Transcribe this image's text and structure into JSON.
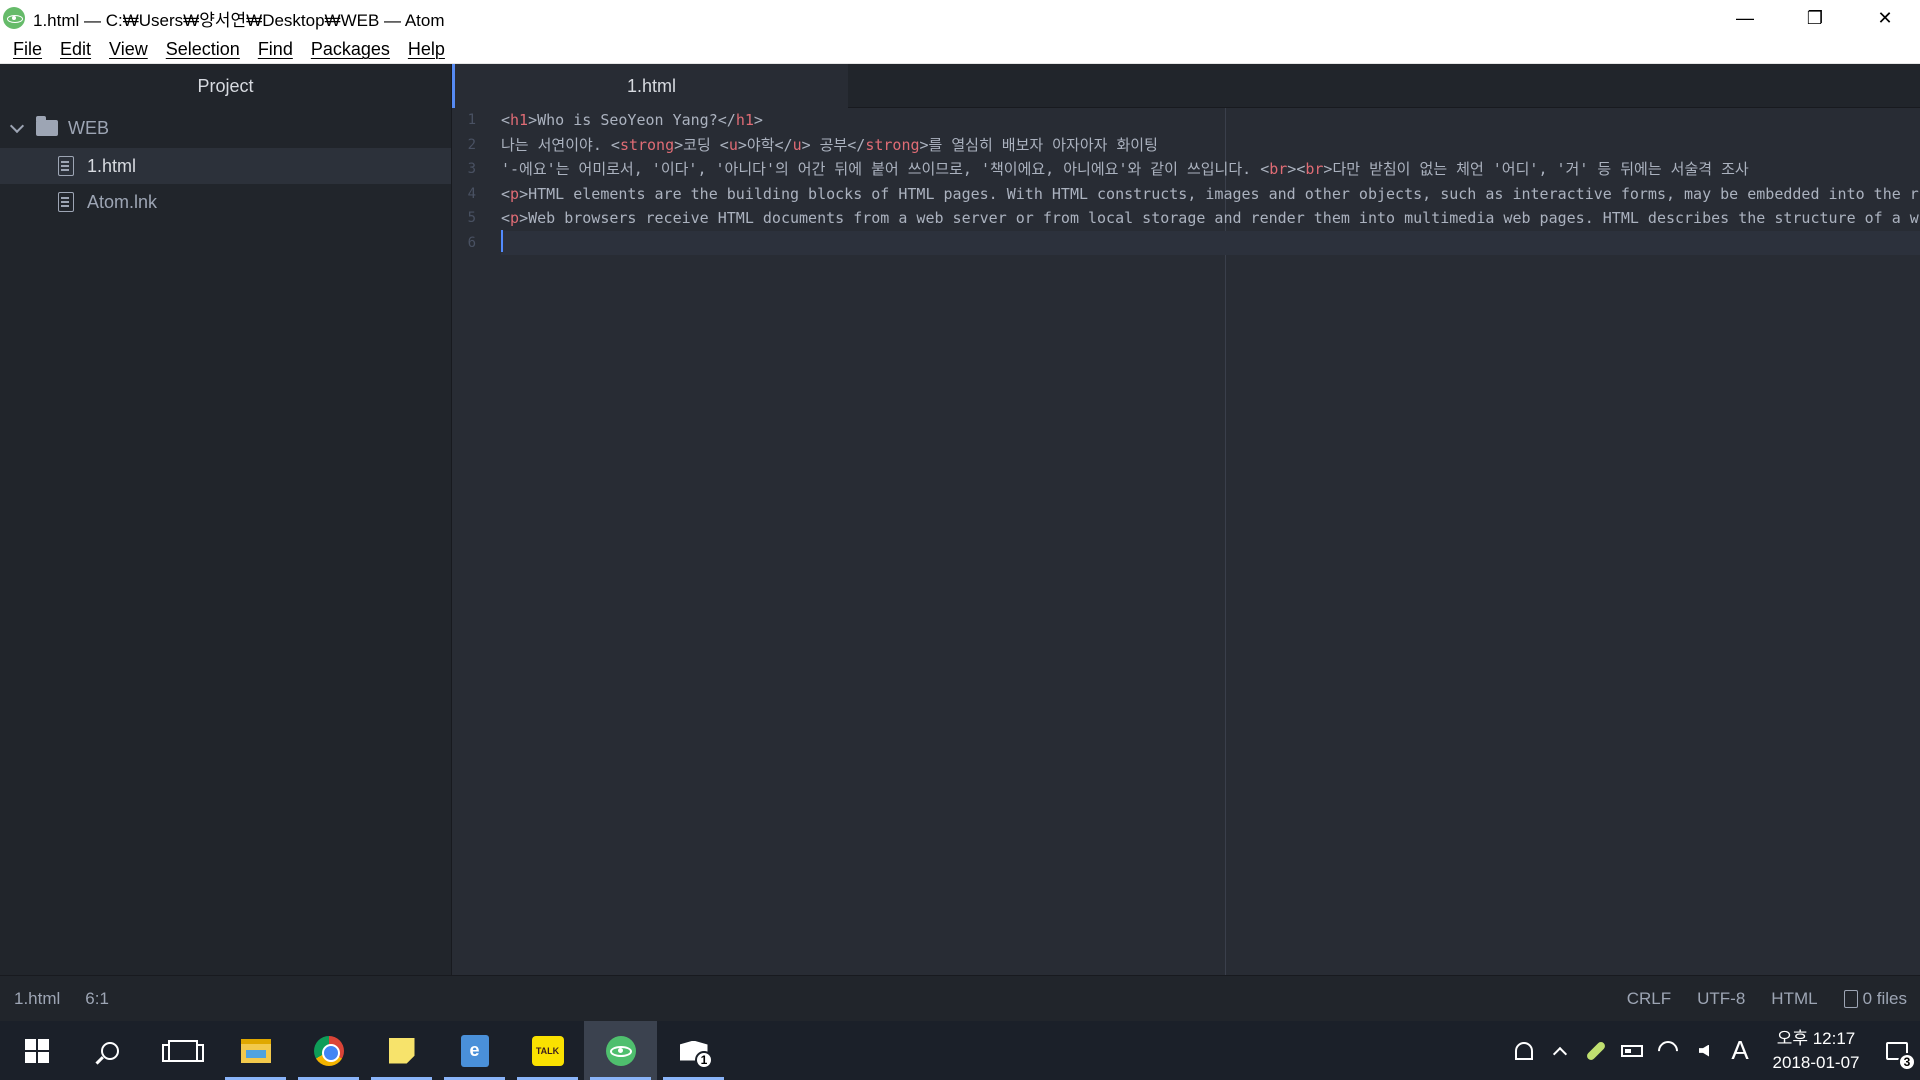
{
  "window": {
    "title": "1.html — C:₩Users₩양서연₩Desktop₩WEB — Atom",
    "controls": {
      "minimize": "—",
      "restore": "❐",
      "close": "✕"
    }
  },
  "menu": [
    "File",
    "Edit",
    "View",
    "Selection",
    "Find",
    "Packages",
    "Help"
  ],
  "tree": {
    "header": "Project",
    "root": "WEB",
    "files": [
      {
        "name": "1.html",
        "selected": true
      },
      {
        "name": "Atom.lnk",
        "selected": false
      }
    ]
  },
  "tabs": [
    {
      "label": "1.html",
      "active": true
    }
  ],
  "editor": {
    "line_numbers": [
      "1",
      "2",
      "3",
      "4",
      "5",
      "6"
    ],
    "lines": [
      [
        {
          "t": "<",
          "c": "punct"
        },
        {
          "t": "h1",
          "c": "tag"
        },
        {
          "t": ">Who is SeoYeon Yang?</",
          "c": "punct"
        },
        {
          "t": "h1",
          "c": "tag"
        },
        {
          "t": ">",
          "c": "punct"
        }
      ],
      [
        {
          "t": "나는 서연이야. <",
          "c": "punct"
        },
        {
          "t": "strong",
          "c": "tag"
        },
        {
          "t": ">코딩 <",
          "c": "punct"
        },
        {
          "t": "u",
          "c": "tag"
        },
        {
          "t": ">야학</",
          "c": "punct"
        },
        {
          "t": "u",
          "c": "tag"
        },
        {
          "t": "> 공부</",
          "c": "punct"
        },
        {
          "t": "strong",
          "c": "tag"
        },
        {
          "t": ">를 열심히 배보자 아자아자 화이팅",
          "c": "punct"
        }
      ],
      [
        {
          "t": "'-에요'는 어미로서, '이다', '아니다'의 어간 뒤에 붙어 쓰이므로, '책이에요, 아니에요'와 같이 쓰입니다. <",
          "c": "punct"
        },
        {
          "t": "br",
          "c": "tag"
        },
        {
          "t": "><",
          "c": "punct"
        },
        {
          "t": "br",
          "c": "tag"
        },
        {
          "t": ">다만 받침이 없는 체언 '어디', '거' 등 뒤에는 서술격 조사",
          "c": "punct"
        }
      ],
      [
        {
          "t": "<",
          "c": "punct"
        },
        {
          "t": "p",
          "c": "tag"
        },
        {
          "t": ">HTML elements are the building blocks of HTML pages. With HTML constructs, images and other objects, such as interactive forms, may be embedded into the r",
          "c": "punct"
        }
      ],
      [
        {
          "t": "<",
          "c": "punct"
        },
        {
          "t": "p",
          "c": "tag"
        },
        {
          "t": ">Web browsers receive HTML documents from a web server or from local storage and render them into multimedia web pages. HTML describes the structure of a w",
          "c": "punct"
        }
      ],
      [
        {
          "t": "",
          "c": "punct"
        }
      ]
    ]
  },
  "status": {
    "file": "1.html",
    "cursor": "6:1",
    "line_ending": "CRLF",
    "encoding": "UTF-8",
    "grammar": "HTML",
    "files": "0 files"
  },
  "taskbar": {
    "apps": [
      {
        "name": "start",
        "running": false
      },
      {
        "name": "search",
        "running": false
      },
      {
        "name": "task-view",
        "running": false
      },
      {
        "name": "file-explorer",
        "running": true
      },
      {
        "name": "chrome",
        "running": true
      },
      {
        "name": "sticky-notes",
        "running": true
      },
      {
        "name": "dictionary",
        "running": true
      },
      {
        "name": "kakaotalk",
        "running": true,
        "label": "TALK"
      },
      {
        "name": "atom",
        "running": true,
        "active": true
      },
      {
        "name": "mail",
        "running": true,
        "badge": "1"
      }
    ],
    "ime": "A",
    "time": "오후 12:17",
    "date": "2018-01-07",
    "notifications": "3"
  }
}
